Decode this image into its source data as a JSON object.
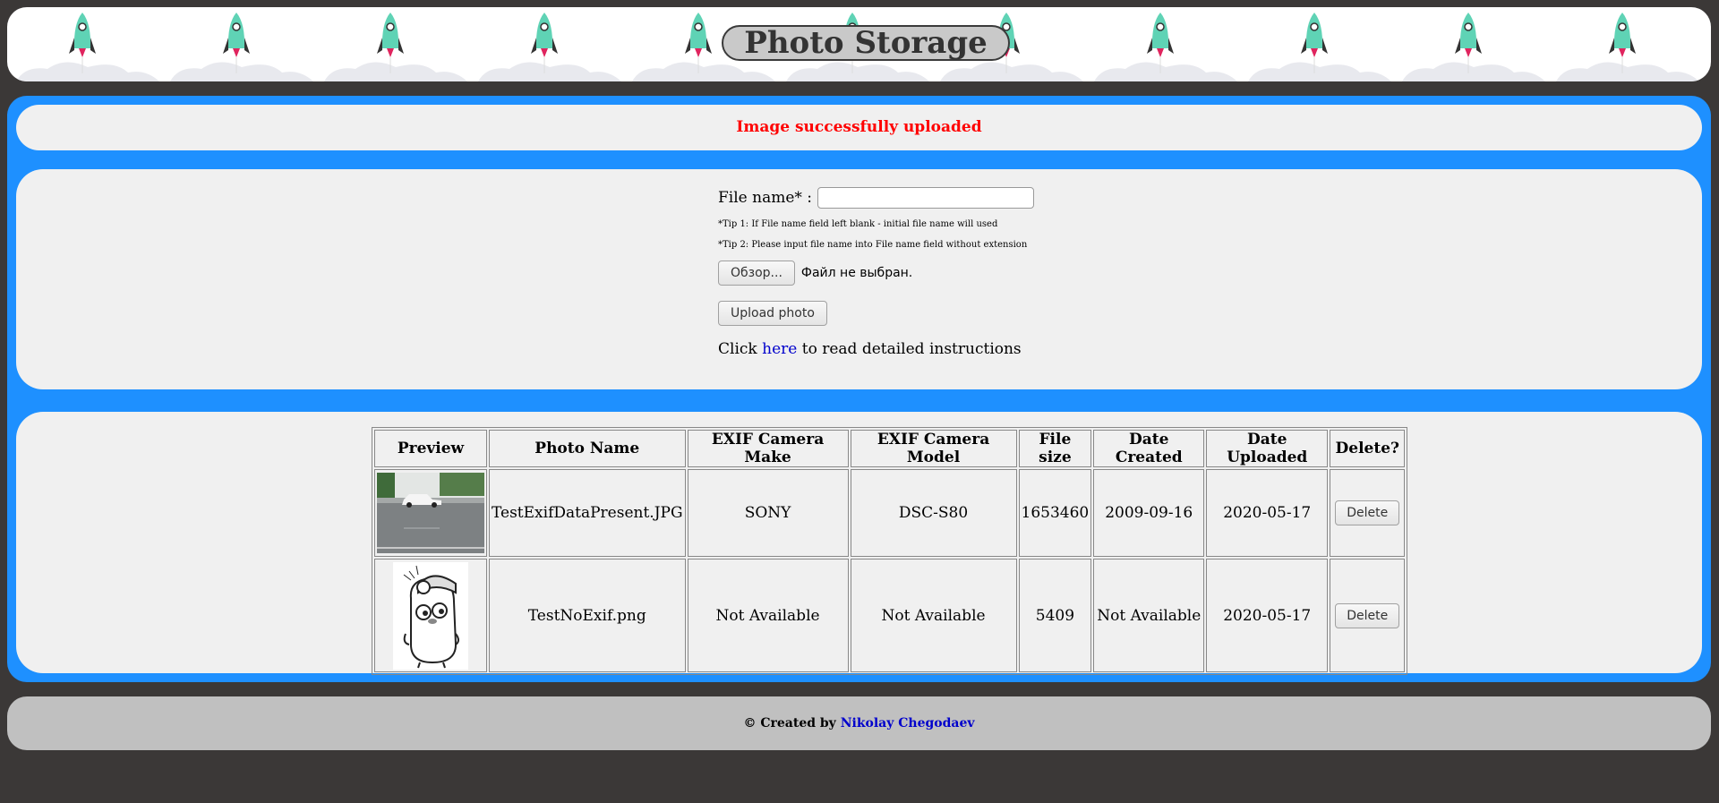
{
  "header": {
    "title": "Photo Storage"
  },
  "message": "Image successfully uploaded",
  "form": {
    "file_name_label": "File name* :",
    "file_name_value": "",
    "tip1": "*Tip 1: If File name field left blank - initial file name will used",
    "tip2": "*Tip 2: Please input file name into File name field without extension",
    "browse_label": "Обзор...",
    "file_status": "Файл не выбран.",
    "upload_label": "Upload photo",
    "instructions_prefix": "Click",
    "instructions_link": "here",
    "instructions_suffix": "to read detailed instructions"
  },
  "table": {
    "headers": [
      "Preview",
      "Photo Name",
      "EXIF Camera Make",
      "EXIF Camera Model",
      "File size",
      "Date Created",
      "Date Uploaded",
      "Delete?"
    ],
    "rows": [
      {
        "name": "TestExifDataPresent.JPG",
        "make": "SONY",
        "model": "DSC-S80",
        "size": "1653460",
        "created": "2009-09-16",
        "uploaded": "2020-05-17",
        "delete_label": "Delete"
      },
      {
        "name": "TestNoExif.png",
        "make": "Not Available",
        "model": "Not Available",
        "size": "5409",
        "created": "Not Available",
        "uploaded": "2020-05-17",
        "delete_label": "Delete"
      }
    ]
  },
  "footer": {
    "prefix": "© Created by",
    "author": "Nikolay Chegodaev"
  },
  "colors": {
    "accent_blue": "#1e90ff",
    "message_red": "#ff0000",
    "link_blue": "#0000cc",
    "rocket": "#5fd3b5"
  },
  "icons": [
    "rocket-icon",
    "cloud-icon"
  ]
}
